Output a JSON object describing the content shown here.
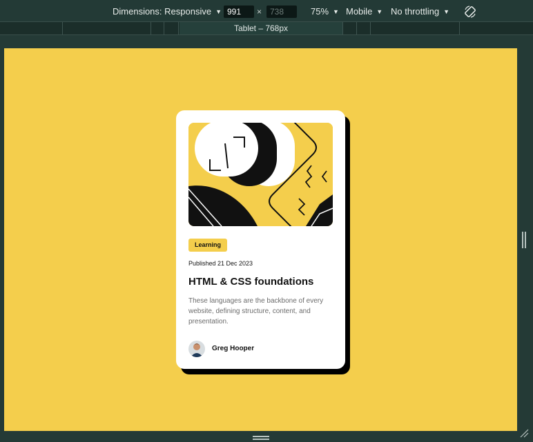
{
  "toolbar": {
    "dimensions_label": "Dimensions: Responsive",
    "width_value": "991",
    "height_value": "738",
    "times_symbol": "×",
    "zoom_label": "75%",
    "device_label": "Mobile",
    "throttling_label": "No throttling",
    "dropdown_caret": "▼",
    "rotate_icon": "rotate-icon"
  },
  "ruler": {
    "breakpoint_label": "Tablet – 768px"
  },
  "card": {
    "category_tag": "Learning",
    "published": "Published 21 Dec 2023",
    "title": "HTML & CSS foundations",
    "description": "These languages are the backbone of every website, defining structure, content, and presentation.",
    "author_name": "Greg Hooper"
  },
  "colors": {
    "page_background": "#f4ce4c",
    "card_background": "#ffffff",
    "card_shadow": "#000000",
    "devtools_background": "#233a36",
    "text_primary": "#111111",
    "text_secondary": "#6b6b6b"
  }
}
